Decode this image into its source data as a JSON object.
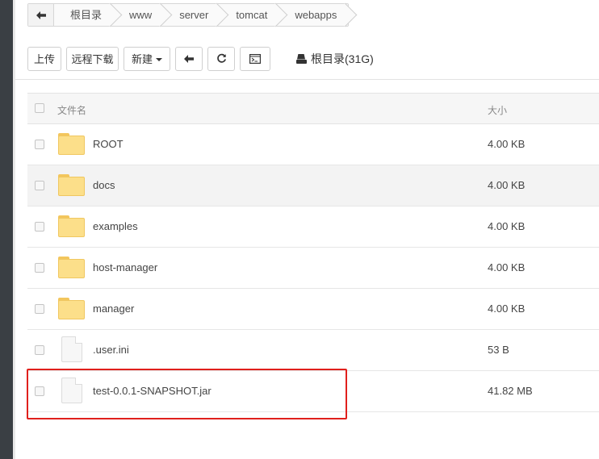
{
  "breadcrumb": {
    "back_icon": "arrow-left-icon",
    "items": [
      "根目录",
      "www",
      "server",
      "tomcat",
      "webapps"
    ]
  },
  "toolbar": {
    "upload_label": "上传",
    "remote_download_label": "远程下载",
    "new_label": "新建",
    "back_icon": "arrow-left-icon",
    "refresh_icon": "refresh-icon",
    "terminal_icon": "terminal-icon",
    "disk_label": "根目录(31G)"
  },
  "table": {
    "headers": {
      "name": "文件名",
      "size": "大小"
    },
    "rows": [
      {
        "name": "ROOT",
        "size": "4.00 KB",
        "type": "folder"
      },
      {
        "name": "docs",
        "size": "4.00 KB",
        "type": "folder"
      },
      {
        "name": "examples",
        "size": "4.00 KB",
        "type": "folder"
      },
      {
        "name": "host-manager",
        "size": "4.00 KB",
        "type": "folder"
      },
      {
        "name": "manager",
        "size": "4.00 KB",
        "type": "folder"
      },
      {
        "name": ".user.ini",
        "size": "53 B",
        "type": "file"
      },
      {
        "name": "test-0.0.1-SNAPSHOT.jar",
        "size": "41.82 MB",
        "type": "file"
      }
    ]
  },
  "colors": {
    "highlight": "#e0201c",
    "folder": "#fcdf8a",
    "sidebar": "#3a3f44"
  }
}
